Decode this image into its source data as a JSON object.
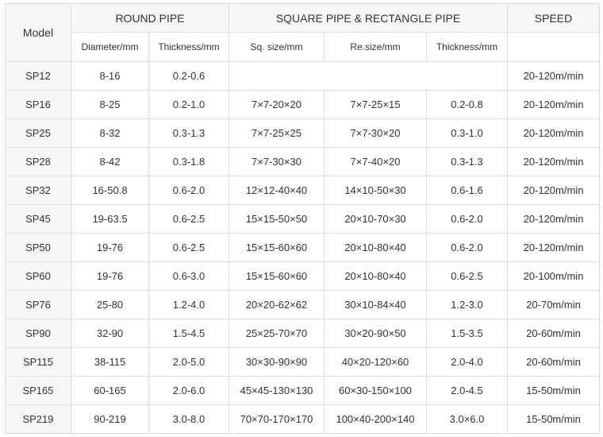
{
  "headers": {
    "model": "Model",
    "round_pipe": "ROUND PIPE",
    "square_pipe": "SQUARE PIPE & RECTANGLE PIPE",
    "speed": "SPEED",
    "diameter": "Diameter/mm",
    "thickness": "Thickness/mm",
    "sq_size": "Sq. size/mm",
    "re_size": "Re.size/mm",
    "thickness2": "Thickness/mm"
  },
  "rows": [
    {
      "model": "SP12",
      "diameter": "8-16",
      "thickness": "0.2-0.6",
      "sq": "",
      "re": "",
      "thickness2": "",
      "speed": "20-120m/min"
    },
    {
      "model": "SP16",
      "diameter": "8-25",
      "thickness": "0.2-1.0",
      "sq": "7×7-20×20",
      "re": "7×7-25×15",
      "thickness2": "0.2-0.8",
      "speed": "20-120m/min"
    },
    {
      "model": "SP25",
      "diameter": "8-32",
      "thickness": "0.3-1.3",
      "sq": "7×7-25×25",
      "re": "7×7-30×20",
      "thickness2": "0.3-1.0",
      "speed": "20-120m/min"
    },
    {
      "model": "SP28",
      "diameter": "8-42",
      "thickness": "0.3-1.8",
      "sq": "7×7-30×30",
      "re": "7×7-40×20",
      "thickness2": "0.3-1.3",
      "speed": "20-120m/min"
    },
    {
      "model": "SP32",
      "diameter": "16-50.8",
      "thickness": "0.6-2.0",
      "sq": "12×12-40×40",
      "re": "14×10-50×30",
      "thickness2": "0.6-1.6",
      "speed": "20-120m/min"
    },
    {
      "model": "SP45",
      "diameter": "19-63.5",
      "thickness": "0.6-2.5",
      "sq": "15×15-50×50",
      "re": "20×10-70×30",
      "thickness2": "0.6-2.0",
      "speed": "20-120m/min"
    },
    {
      "model": "SP50",
      "diameter": "19-76",
      "thickness": "0.6-2.5",
      "sq": "15×15-60×60",
      "re": "20×10-80×40",
      "thickness2": "0.6-2.0",
      "speed": "20-120m/min"
    },
    {
      "model": "SP60",
      "diameter": "19-76",
      "thickness": "0.6-3.0",
      "sq": "15×15-60×60",
      "re": "20×10-80×40",
      "thickness2": "0.6-2.5",
      "speed": "20-100m/min"
    },
    {
      "model": "SP76",
      "diameter": "25-80",
      "thickness": "1.2-4.0",
      "sq": "20×20-62×62",
      "re": "30×10-84×40",
      "thickness2": "1.2-3.0",
      "speed": "20-70m/min"
    },
    {
      "model": "SP90",
      "diameter": "32-90",
      "thickness": "1.5-4.5",
      "sq": "25×25-70×70",
      "re": "30×20-90×50",
      "thickness2": "1.5-3.5",
      "speed": "20-60m/min"
    },
    {
      "model": "SP115",
      "diameter": "38-115",
      "thickness": "2.0-5.0",
      "sq": "30×30-90×90",
      "re": "40×20-120×60",
      "thickness2": "2.0-4.0",
      "speed": "20-60m/min"
    },
    {
      "model": "SP165",
      "diameter": "60-165",
      "thickness": "2.0-6.0",
      "sq": "45×45-130×130",
      "re": "60×30-150×100",
      "thickness2": "2.0-4.5",
      "speed": "15-50m/min"
    },
    {
      "model": "SP219",
      "diameter": "90-219",
      "thickness": "3.0-8.0",
      "sq": "70×70-170×170",
      "re": "100×40-200×140",
      "thickness2": "3.0×6.0",
      "speed": "15-50m/min"
    }
  ]
}
